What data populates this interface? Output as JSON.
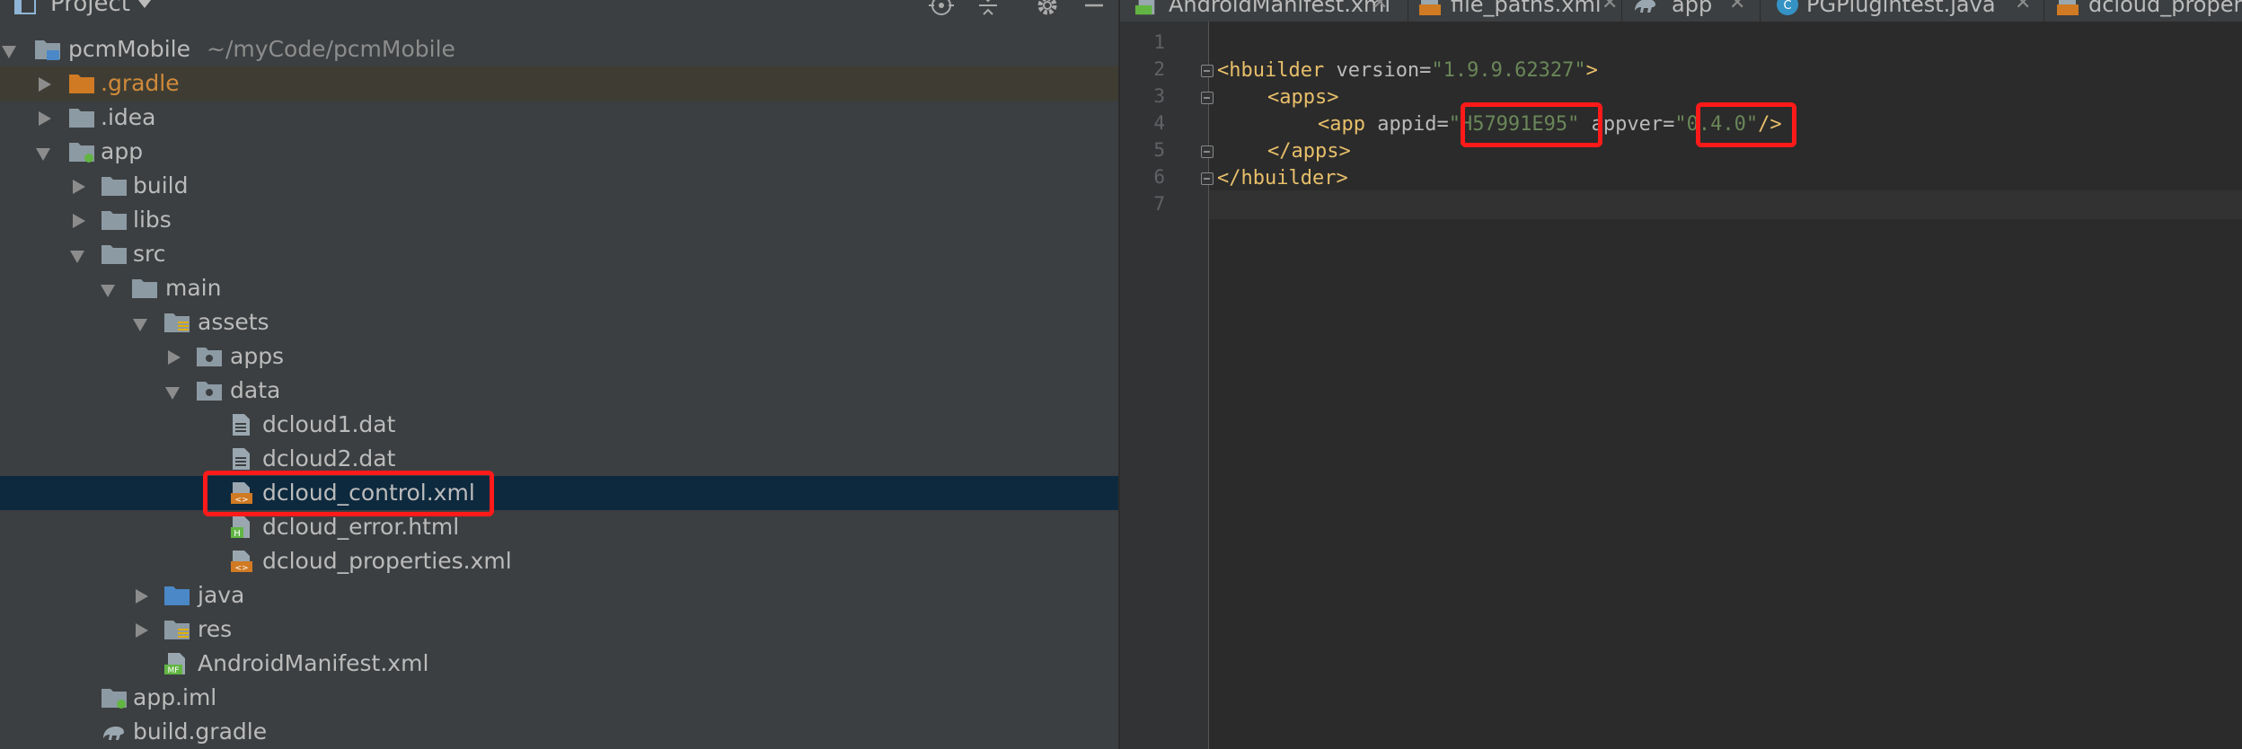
{
  "project_panel": {
    "title": "Project",
    "header_icons": [
      "locate-icon",
      "collapse-icon",
      "gear-icon",
      "minimize-icon"
    ],
    "tree": [
      {
        "label": "pcmMobile",
        "sub": "~/myCode/pcmMobile",
        "icon": "module-folder-icon"
      },
      {
        "label": ".gradle",
        "icon": "folder-icon"
      },
      {
        "label": ".idea",
        "icon": "folder-icon"
      },
      {
        "label": "app",
        "icon": "module-folder-icon"
      },
      {
        "label": "build",
        "icon": "folder-icon"
      },
      {
        "label": "libs",
        "icon": "folder-icon"
      },
      {
        "label": "src",
        "icon": "folder-icon"
      },
      {
        "label": "main",
        "icon": "folder-icon"
      },
      {
        "label": "assets",
        "icon": "resources-folder-icon"
      },
      {
        "label": "apps",
        "icon": "folder-icon"
      },
      {
        "label": "data",
        "icon": "folder-icon"
      },
      {
        "label": "dcloud1.dat",
        "icon": "text-file-icon"
      },
      {
        "label": "dcloud2.dat",
        "icon": "text-file-icon"
      },
      {
        "label": "dcloud_control.xml",
        "icon": "xml-file-icon"
      },
      {
        "label": "dcloud_error.html",
        "icon": "html-file-icon"
      },
      {
        "label": "dcloud_properties.xml",
        "icon": "xml-file-icon"
      },
      {
        "label": "java",
        "icon": "source-folder-icon"
      },
      {
        "label": "res",
        "icon": "resources-folder-icon"
      },
      {
        "label": "AndroidManifest.xml",
        "icon": "manifest-file-icon"
      },
      {
        "label": "app.iml",
        "icon": "iml-file-icon"
      },
      {
        "label": "build.gradle",
        "icon": "gradle-icon"
      }
    ]
  },
  "editor": {
    "tabs": [
      {
        "label": "AndroidManifest.xml",
        "icon": "manifest-file-icon"
      },
      {
        "label": "file_paths.xml",
        "icon": "xml-file-icon"
      },
      {
        "label": "app",
        "icon": "gradle-icon"
      },
      {
        "label": "PGPlugintest.java",
        "icon": "java-class-icon"
      },
      {
        "label": "dcloud_properties.xml",
        "icon": "xml-file-icon"
      }
    ],
    "line_numbers": [
      "1",
      "2",
      "3",
      "4",
      "5",
      "6",
      "7"
    ],
    "code": {
      "l2_open": "<hbuilder",
      "l2_attr": " version=",
      "l2_val": "\"1.9.9.62327\"",
      "l2_close": ">",
      "l3": "<apps>",
      "l4_open": "<app",
      "l4_attr1": " appid=",
      "l4_val1": "\"H57991E95\"",
      "l4_attr2": " appver=",
      "l4_val2": "\"0.4.0\"",
      "l4_close": "/>",
      "l5": "</apps>",
      "l6": "</hbuilder>"
    }
  },
  "colors": {
    "panel_bg": "#3c3f41",
    "editor_bg": "#2b2b2b",
    "selection": "#0d293e",
    "annotation_red": "#ff1a1a",
    "xml_tag": "#e8bf6a",
    "xml_value": "#6a8759"
  }
}
